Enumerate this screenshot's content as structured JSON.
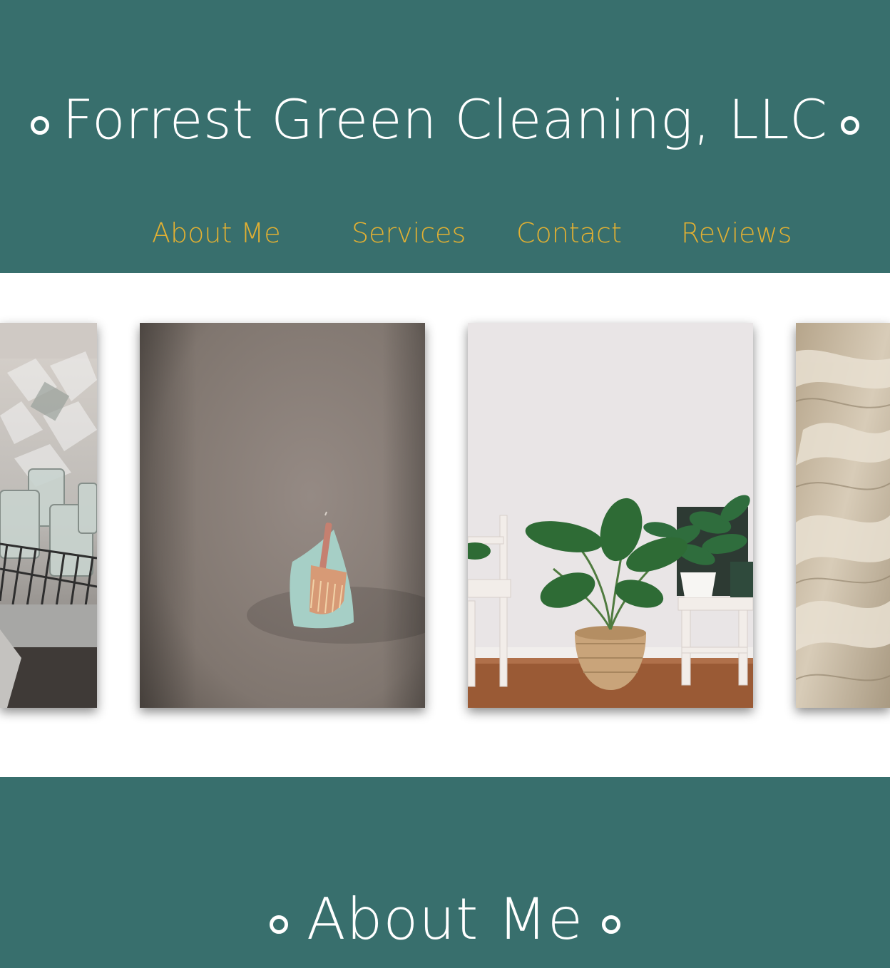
{
  "header": {
    "site_title": "Forrest Green Cleaning, LLC",
    "background_color": "#386f6d",
    "title_color": "#ffffff"
  },
  "nav": {
    "link_color": "#e2b032",
    "items": [
      {
        "label": "About Me"
      },
      {
        "label": "Services"
      },
      {
        "label": "Contact"
      },
      {
        "label": "Reviews"
      }
    ]
  },
  "gallery": {
    "photos": [
      {
        "subject": "glasses-on-drying-rack"
      },
      {
        "subject": "dustpan-and-brush-on-wall"
      },
      {
        "subject": "potted-plants-and-stools"
      },
      {
        "subject": "white-bed-linens"
      }
    ]
  },
  "about": {
    "heading": "About Me"
  }
}
